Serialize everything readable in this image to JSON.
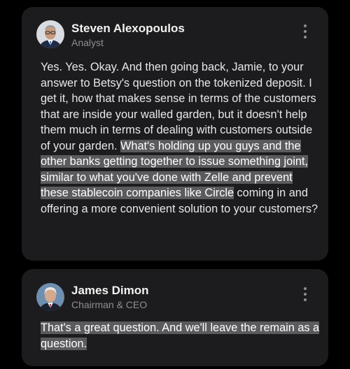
{
  "messages": [
    {
      "speaker": "Steven Alexopoulos",
      "role": "Analyst",
      "avatar_icon": "person-photo-glasses",
      "text_plain": "Yes. Yes. Okay. And then going back, Jamie, to your answer to Betsy's question on the tokenized deposit. I get it, how that makes sense in terms of the customers that are inside your walled garden, but it doesn't help them much in terms of dealing with customers outside of your garden. ",
      "text_highlight": "What's holding up you guys and the other banks getting together to issue something joint, similar to what you've done with Zelle and prevent these stablecoin companies like Circle",
      "text_after": " coming in and offering a more convenient solution to your customers?"
    },
    {
      "speaker": "James Dimon",
      "role": "Chairman & CEO",
      "avatar_icon": "person-photo-grey-hair",
      "text_plain": "",
      "text_highlight": "That's a great question. And we'll leave the remain as a question.",
      "text_after": ""
    }
  ],
  "colors": {
    "background": "#000000",
    "card": "#1c1c1e",
    "highlight": "#5b5b5e",
    "secondary_text": "#8e8e93"
  }
}
